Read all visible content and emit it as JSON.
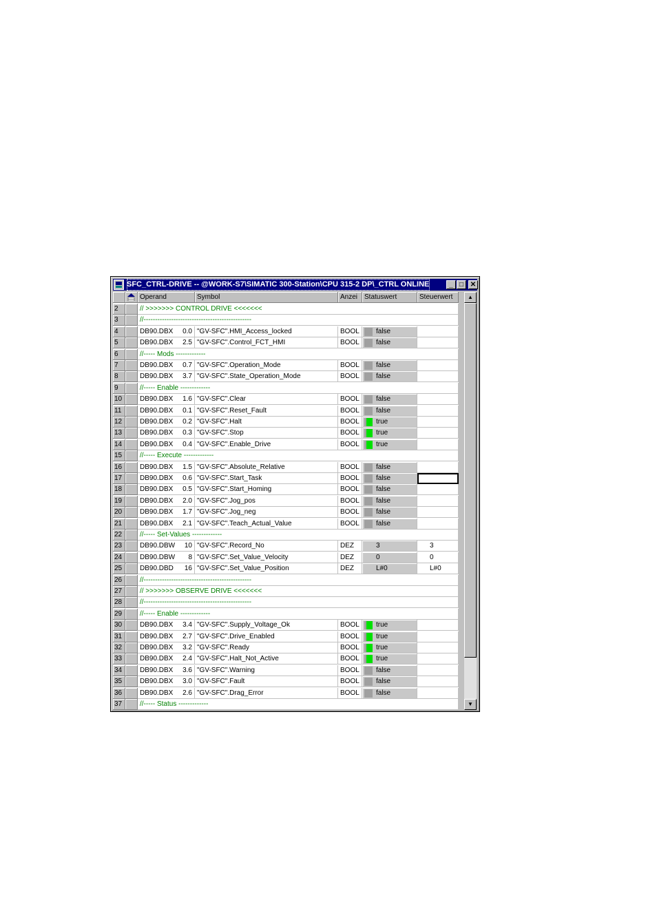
{
  "window": {
    "title": "SFC_CTRL-DRIVE -- @WORK-S7\\SIMATIC 300-Station\\CPU 315-2 DP\\_CTRL  ONLINE",
    "minimize": "_",
    "maximize": "□",
    "close": "✕"
  },
  "columns": {
    "operand": "Operand",
    "symbol": "Symbol",
    "format": "Anzei",
    "status": "Statuswert",
    "control": "Steuerwert"
  },
  "rows": [
    {
      "num": "2",
      "comment": "// >>>>>>>    CONTROL DRIVE    <<<<<<<"
    },
    {
      "num": "3",
      "comment": "//-----------------------------------------------"
    },
    {
      "num": "4",
      "op": "DB90.DBX",
      "bit": "0.0",
      "sym": "\"GV-SFC\".HMI_Access_locked",
      "fmt": "BOOL",
      "led": false,
      "val": "false"
    },
    {
      "num": "5",
      "op": "DB90.DBX",
      "bit": "2.5",
      "sym": "\"GV-SFC\".Control_FCT_HMI",
      "fmt": "BOOL",
      "led": false,
      "val": "false"
    },
    {
      "num": "6",
      "comment": "//-----    Mods      -------------"
    },
    {
      "num": "7",
      "op": "DB90.DBX",
      "bit": "0.7",
      "sym": "\"GV-SFC\".Operation_Mode",
      "fmt": "BOOL",
      "led": false,
      "val": "false"
    },
    {
      "num": "8",
      "op": "DB90.DBX",
      "bit": "3.7",
      "sym": "\"GV-SFC\".State_Operation_Mode",
      "fmt": "BOOL",
      "led": false,
      "val": "false"
    },
    {
      "num": "9",
      "comment": "//-----    Enable     -------------"
    },
    {
      "num": "10",
      "op": "DB90.DBX",
      "bit": "1.6",
      "sym": "\"GV-SFC\".Clear",
      "fmt": "BOOL",
      "led": false,
      "val": "false"
    },
    {
      "num": "11",
      "op": "DB90.DBX",
      "bit": "0.1",
      "sym": "\"GV-SFC\".Reset_Fault",
      "fmt": "BOOL",
      "led": false,
      "val": "false"
    },
    {
      "num": "12",
      "op": "DB90.DBX",
      "bit": "0.2",
      "sym": "\"GV-SFC\".Halt",
      "fmt": "BOOL",
      "led": true,
      "val": "true"
    },
    {
      "num": "13",
      "op": "DB90.DBX",
      "bit": "0.3",
      "sym": "\"GV-SFC\".Stop",
      "fmt": "BOOL",
      "led": true,
      "val": "true"
    },
    {
      "num": "14",
      "op": "DB90.DBX",
      "bit": "0.4",
      "sym": "\"GV-SFC\".Enable_Drive",
      "fmt": "BOOL",
      "led": true,
      "val": "true"
    },
    {
      "num": "15",
      "comment": "//-----    Execute     -------------"
    },
    {
      "num": "16",
      "op": "DB90.DBX",
      "bit": "1.5",
      "sym": "\"GV-SFC\".Absolute_Relative",
      "fmt": "BOOL",
      "led": false,
      "val": "false"
    },
    {
      "num": "17",
      "op": "DB90.DBX",
      "bit": "0.6",
      "sym": "\"GV-SFC\".Start_Task",
      "fmt": "BOOL",
      "led": false,
      "val": "false",
      "focus": true
    },
    {
      "num": "18",
      "op": "DB90.DBX",
      "bit": "0.5",
      "sym": "\"GV-SFC\".Start_Homing",
      "fmt": "BOOL",
      "led": false,
      "val": "false"
    },
    {
      "num": "19",
      "op": "DB90.DBX",
      "bit": "2.0",
      "sym": "\"GV-SFC\".Jog_pos",
      "fmt": "BOOL",
      "led": false,
      "val": "false"
    },
    {
      "num": "20",
      "op": "DB90.DBX",
      "bit": "1.7",
      "sym": "\"GV-SFC\".Jog_neg",
      "fmt": "BOOL",
      "led": false,
      "val": "false"
    },
    {
      "num": "21",
      "op": "DB90.DBX",
      "bit": "2.1",
      "sym": "\"GV-SFC\".Teach_Actual_Value",
      "fmt": "BOOL",
      "led": false,
      "val": "false"
    },
    {
      "num": "22",
      "comment": "//-----    Set-Values     -------------"
    },
    {
      "num": "23",
      "op": "DB90.DBW",
      "bit": "10",
      "sym": "\"GV-SFC\".Record_No",
      "fmt": "DEZ",
      "val": "3",
      "ctrl": "3"
    },
    {
      "num": "24",
      "op": "DB90.DBW",
      "bit": "8",
      "sym": "\"GV-SFC\".Set_Value_Velocity",
      "fmt": "DEZ",
      "val": "0",
      "ctrl": "0"
    },
    {
      "num": "25",
      "op": "DB90.DBD",
      "bit": "16",
      "sym": "\"GV-SFC\".Set_Value_Position",
      "fmt": "DEZ",
      "val": "L#0",
      "ctrl": "L#0"
    },
    {
      "num": "26",
      "comment": "//-----------------------------------------------"
    },
    {
      "num": "27",
      "comment": "// >>>>>>>    OBSERVE DRIVE    <<<<<<<"
    },
    {
      "num": "28",
      "comment": "//-----------------------------------------------"
    },
    {
      "num": "29",
      "comment": "//-----    Enable     -------------"
    },
    {
      "num": "30",
      "op": "DB90.DBX",
      "bit": "3.4",
      "sym": "\"GV-SFC\".Supply_Voltage_Ok",
      "fmt": "BOOL",
      "led": true,
      "val": "true"
    },
    {
      "num": "31",
      "op": "DB90.DBX",
      "bit": "2.7",
      "sym": "\"GV-SFC\".Drive_Enabled",
      "fmt": "BOOL",
      "led": true,
      "val": "true"
    },
    {
      "num": "32",
      "op": "DB90.DBX",
      "bit": "3.2",
      "sym": "\"GV-SFC\".Ready",
      "fmt": "BOOL",
      "led": true,
      "val": "true"
    },
    {
      "num": "33",
      "op": "DB90.DBX",
      "bit": "2.4",
      "sym": "\"GV-SFC\".Halt_Not_Active",
      "fmt": "BOOL",
      "led": true,
      "val": "true"
    },
    {
      "num": "34",
      "op": "DB90.DBX",
      "bit": "3.6",
      "sym": "\"GV-SFC\".Warning",
      "fmt": "BOOL",
      "led": false,
      "val": "false"
    },
    {
      "num": "35",
      "op": "DB90.DBX",
      "bit": "3.0",
      "sym": "\"GV-SFC\".Fault",
      "fmt": "BOOL",
      "led": false,
      "val": "false"
    },
    {
      "num": "36",
      "op": "DB90.DBX",
      "bit": "2.6",
      "sym": "\"GV-SFC\".Drag_Error",
      "fmt": "BOOL",
      "led": false,
      "val": "false"
    },
    {
      "num": "37",
      "comment": "//-----    Status     -------------"
    }
  ],
  "colors": {
    "led_on": "#00e000",
    "led_off": "#a0a0a0",
    "comment": "#008000",
    "titlebar": "#000080"
  }
}
